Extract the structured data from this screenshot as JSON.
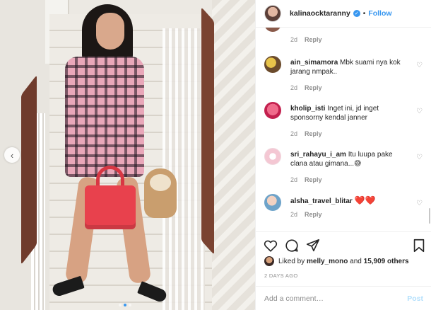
{
  "header": {
    "username": "kalinaocktaranny",
    "separator": "•",
    "follow_label": "Follow"
  },
  "photo": {
    "prev_icon": "‹",
    "dots": 3,
    "active_dot": 1
  },
  "comments": [
    {
      "username": "",
      "text": "",
      "time": "2d",
      "reply": "Reply",
      "avatar_color": "#8a5a4a"
    },
    {
      "username": "ain_simamora",
      "text": "Mbk suami nya kok jarang nmpak..",
      "time": "2d",
      "reply": "Reply",
      "avatar_color": "#c9a23c"
    },
    {
      "username": "kholip_isti",
      "text": "Inget ini, jd inget sponsorny kendal janner",
      "time": "2d",
      "reply": "Reply",
      "avatar_color": "#e23b6b"
    },
    {
      "username": "sri_rahayu_i_am",
      "text": "Itu luupa pake clana atau gimana...😅",
      "time": "2d",
      "reply": "Reply",
      "avatar_color": "#f3c8d4"
    },
    {
      "username": "alsha_travel_blitar",
      "text": "❤️❤️",
      "time": "2d",
      "reply": "Reply",
      "avatar_color": "#6ea3c9"
    }
  ],
  "icons": {
    "like": "heart-outline-icon",
    "comment": "comment-icon",
    "share": "share-icon",
    "save": "bookmark-icon"
  },
  "likes": {
    "prefix": "Liked by",
    "user": "melly_mono",
    "middle": "and",
    "count": "15,909 others"
  },
  "timestamp": "2 DAYS AGO",
  "add_comment": {
    "placeholder": "Add a comment…",
    "post_label": "Post"
  },
  "colors": {
    "accent": "#3897f0",
    "post_disabled": "#b2dffc",
    "heart": "#ed4956"
  }
}
